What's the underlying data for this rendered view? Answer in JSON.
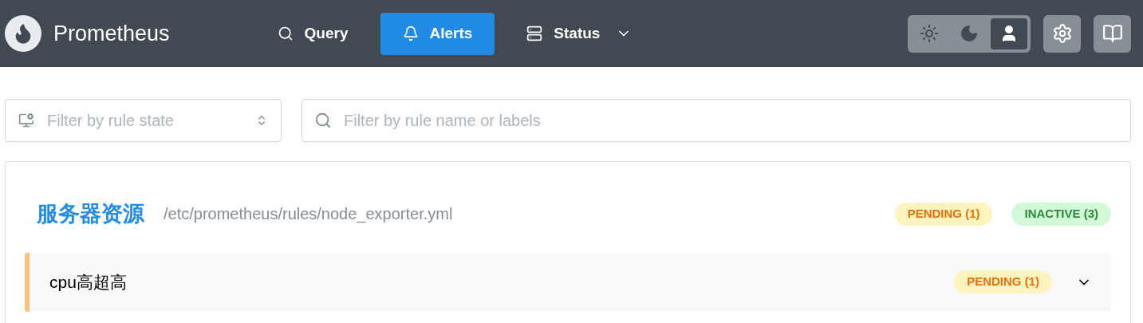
{
  "header": {
    "title": "Prometheus",
    "nav": [
      {
        "label": "Query",
        "selected": false,
        "dropdown": false
      },
      {
        "label": "Alerts",
        "selected": true,
        "dropdown": false
      },
      {
        "label": "Status",
        "selected": false,
        "dropdown": true
      }
    ],
    "theme": [
      {
        "selected": false
      },
      {
        "selected": false
      },
      {
        "selected": true
      }
    ]
  },
  "filters": {
    "state": {
      "placeholder": "Filter by rule state"
    },
    "search": {
      "placeholder": "Filter by rule name or labels"
    }
  },
  "groups": [
    {
      "name": "服务器资源",
      "file": "/etc/prometheus/rules/node_exporter.yml",
      "badges": [
        {
          "kind": "pending",
          "label": "PENDING (1)"
        },
        {
          "kind": "inactive",
          "label": "INACTIVE (3)"
        }
      ],
      "rules": [
        {
          "name": "cpu高超高",
          "kind": "pending",
          "expanded": false,
          "badge": {
            "kind": "pending",
            "label": "PENDING (1)"
          }
        }
      ]
    }
  ]
}
